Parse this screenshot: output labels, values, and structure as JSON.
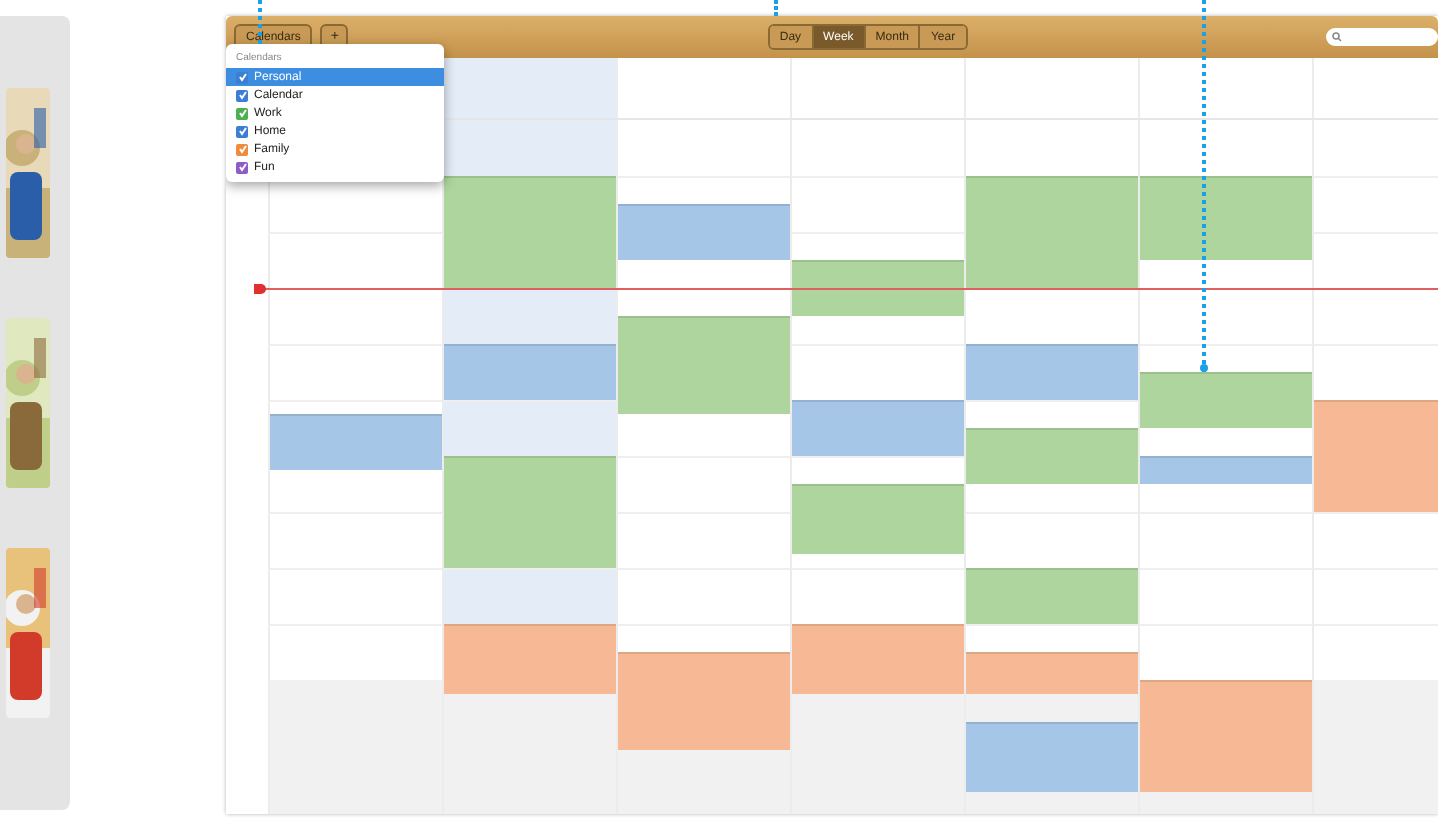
{
  "toolbar": {
    "calendars_button": "Calendars",
    "add_button": "+",
    "views": [
      {
        "label": "Day",
        "selected": false
      },
      {
        "label": "Week",
        "selected": true
      },
      {
        "label": "Month",
        "selected": false
      },
      {
        "label": "Year",
        "selected": false
      }
    ]
  },
  "calendar_menu": {
    "heading": "Calendars",
    "items": [
      {
        "label": "Personal",
        "checked": true,
        "selected": true,
        "color": "#3b7fd4"
      },
      {
        "label": "Calendar",
        "checked": true,
        "selected": false,
        "color": "#3b7fd4"
      },
      {
        "label": "Work",
        "checked": true,
        "selected": false,
        "color": "#4caf50"
      },
      {
        "label": "Home",
        "checked": true,
        "selected": false,
        "color": "#3b7fd4"
      },
      {
        "label": "Family",
        "checked": true,
        "selected": false,
        "color": "#f08a3c"
      },
      {
        "label": "Fun",
        "checked": true,
        "selected": false,
        "color": "#8e5bc8"
      }
    ]
  },
  "week": {
    "columns": [
      {
        "today": false,
        "events": [
          {
            "color": "#a6c6e8"
          }
        ]
      },
      {
        "today": true,
        "events": [
          {
            "color": "#add59d"
          },
          {
            "color": "#a6c6e8"
          },
          {
            "color": "#add59d"
          },
          {
            "color": "#f7b995"
          }
        ]
      },
      {
        "today": false,
        "events": [
          {
            "color": "#a6c6e8"
          },
          {
            "color": "#add59d"
          },
          {
            "color": "#f7b995"
          }
        ]
      },
      {
        "today": false,
        "events": [
          {
            "color": "#add59d"
          },
          {
            "color": "#a6c6e8"
          },
          {
            "color": "#add59d"
          },
          {
            "color": "#f7b995"
          }
        ]
      },
      {
        "today": false,
        "events": [
          {
            "color": "#add59d"
          },
          {
            "color": "#a6c6e8"
          },
          {
            "color": "#add59d"
          },
          {
            "color": "#add59d"
          },
          {
            "color": "#f7b995"
          },
          {
            "color": "#a6c6e8"
          }
        ]
      },
      {
        "today": false,
        "events": [
          {
            "color": "#add59d"
          },
          {
            "color": "#add59d"
          },
          {
            "color": "#a6c6e8"
          },
          {
            "color": "#f7b995"
          }
        ]
      },
      {
        "today": false,
        "events": [
          {
            "color": "#f7b995"
          }
        ]
      }
    ]
  }
}
